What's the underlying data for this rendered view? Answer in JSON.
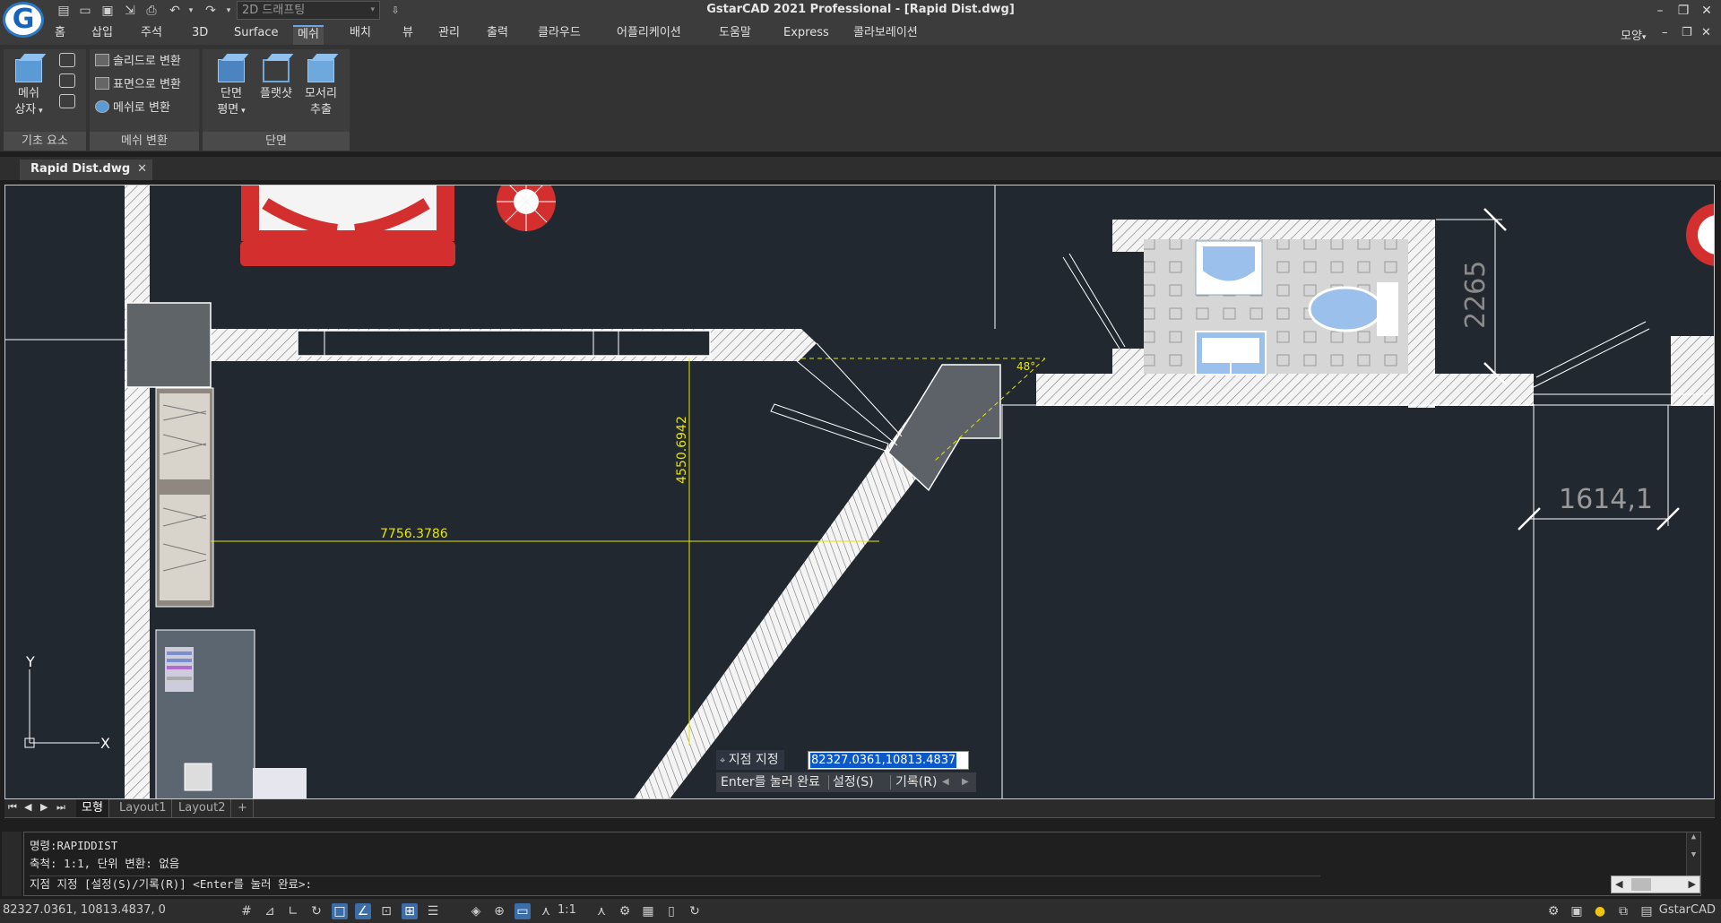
{
  "titlebar": {
    "workspace": "2D 드래프팅",
    "title": "GstarCAD 2021 Professional - [Rapid Dist.dwg]",
    "logo_letter": "G"
  },
  "menu": {
    "tabs": [
      "홈",
      "삽입",
      "주석",
      "3D",
      "Surface",
      "메쉬",
      "배치",
      "뷰",
      "관리",
      "출력",
      "클라우드",
      "어플리케이션",
      "도움말",
      "Express",
      "콜라보레이션"
    ],
    "active": "메쉬",
    "right_label": "모양"
  },
  "ribbon": {
    "basic": {
      "label": "기초 요소",
      "mesh_box": "메쉬",
      "mesh_box2": "상자"
    },
    "convert": {
      "label": "메쉬 변환",
      "to_solid": "솔리드로 변환",
      "to_surface": "표면으로 변환",
      "to_mesh": "메쉬로 변환"
    },
    "section": {
      "label": "단면",
      "plane": "단면",
      "plane2": "평면",
      "flatshot": "플랫샷",
      "edge": "모서리",
      "edge2": "추출"
    }
  },
  "document": {
    "tab": "Rapid Dist.dwg"
  },
  "drawing": {
    "dim_vertical": "4550.6942",
    "dim_horizontal": "7756.3786",
    "dim_angle": "48°",
    "dim_2265": "2265",
    "dim_1614": "1614,1",
    "ucs_x": "X",
    "ucs_y": "Y"
  },
  "dynamic_input": {
    "prompt": "지점 지정",
    "value": "82327.0361,10813.4837",
    "hint": "Enter를 눌러 완료",
    "opt_settings": "설정(S)",
    "opt_history": "기록(R)"
  },
  "layout_tabs": [
    "모형",
    "Layout1",
    "Layout2",
    "+"
  ],
  "command": {
    "line1": "명령:RAPIDDIST",
    "line2": "축척: 1:1, 단위 변환: 없음",
    "line3": "지점 지정 [설정(S)/기록(R)] <Enter를 눌러 완료>:"
  },
  "status": {
    "coords": "82327.0361, 10813.4837, 0",
    "scale": "1:1",
    "brand": "GstarCAD"
  },
  "colors": {
    "accent": "#3b6ea8",
    "canvas": "#212830",
    "dimension": "#e6e600",
    "red": "#d32f2f"
  }
}
